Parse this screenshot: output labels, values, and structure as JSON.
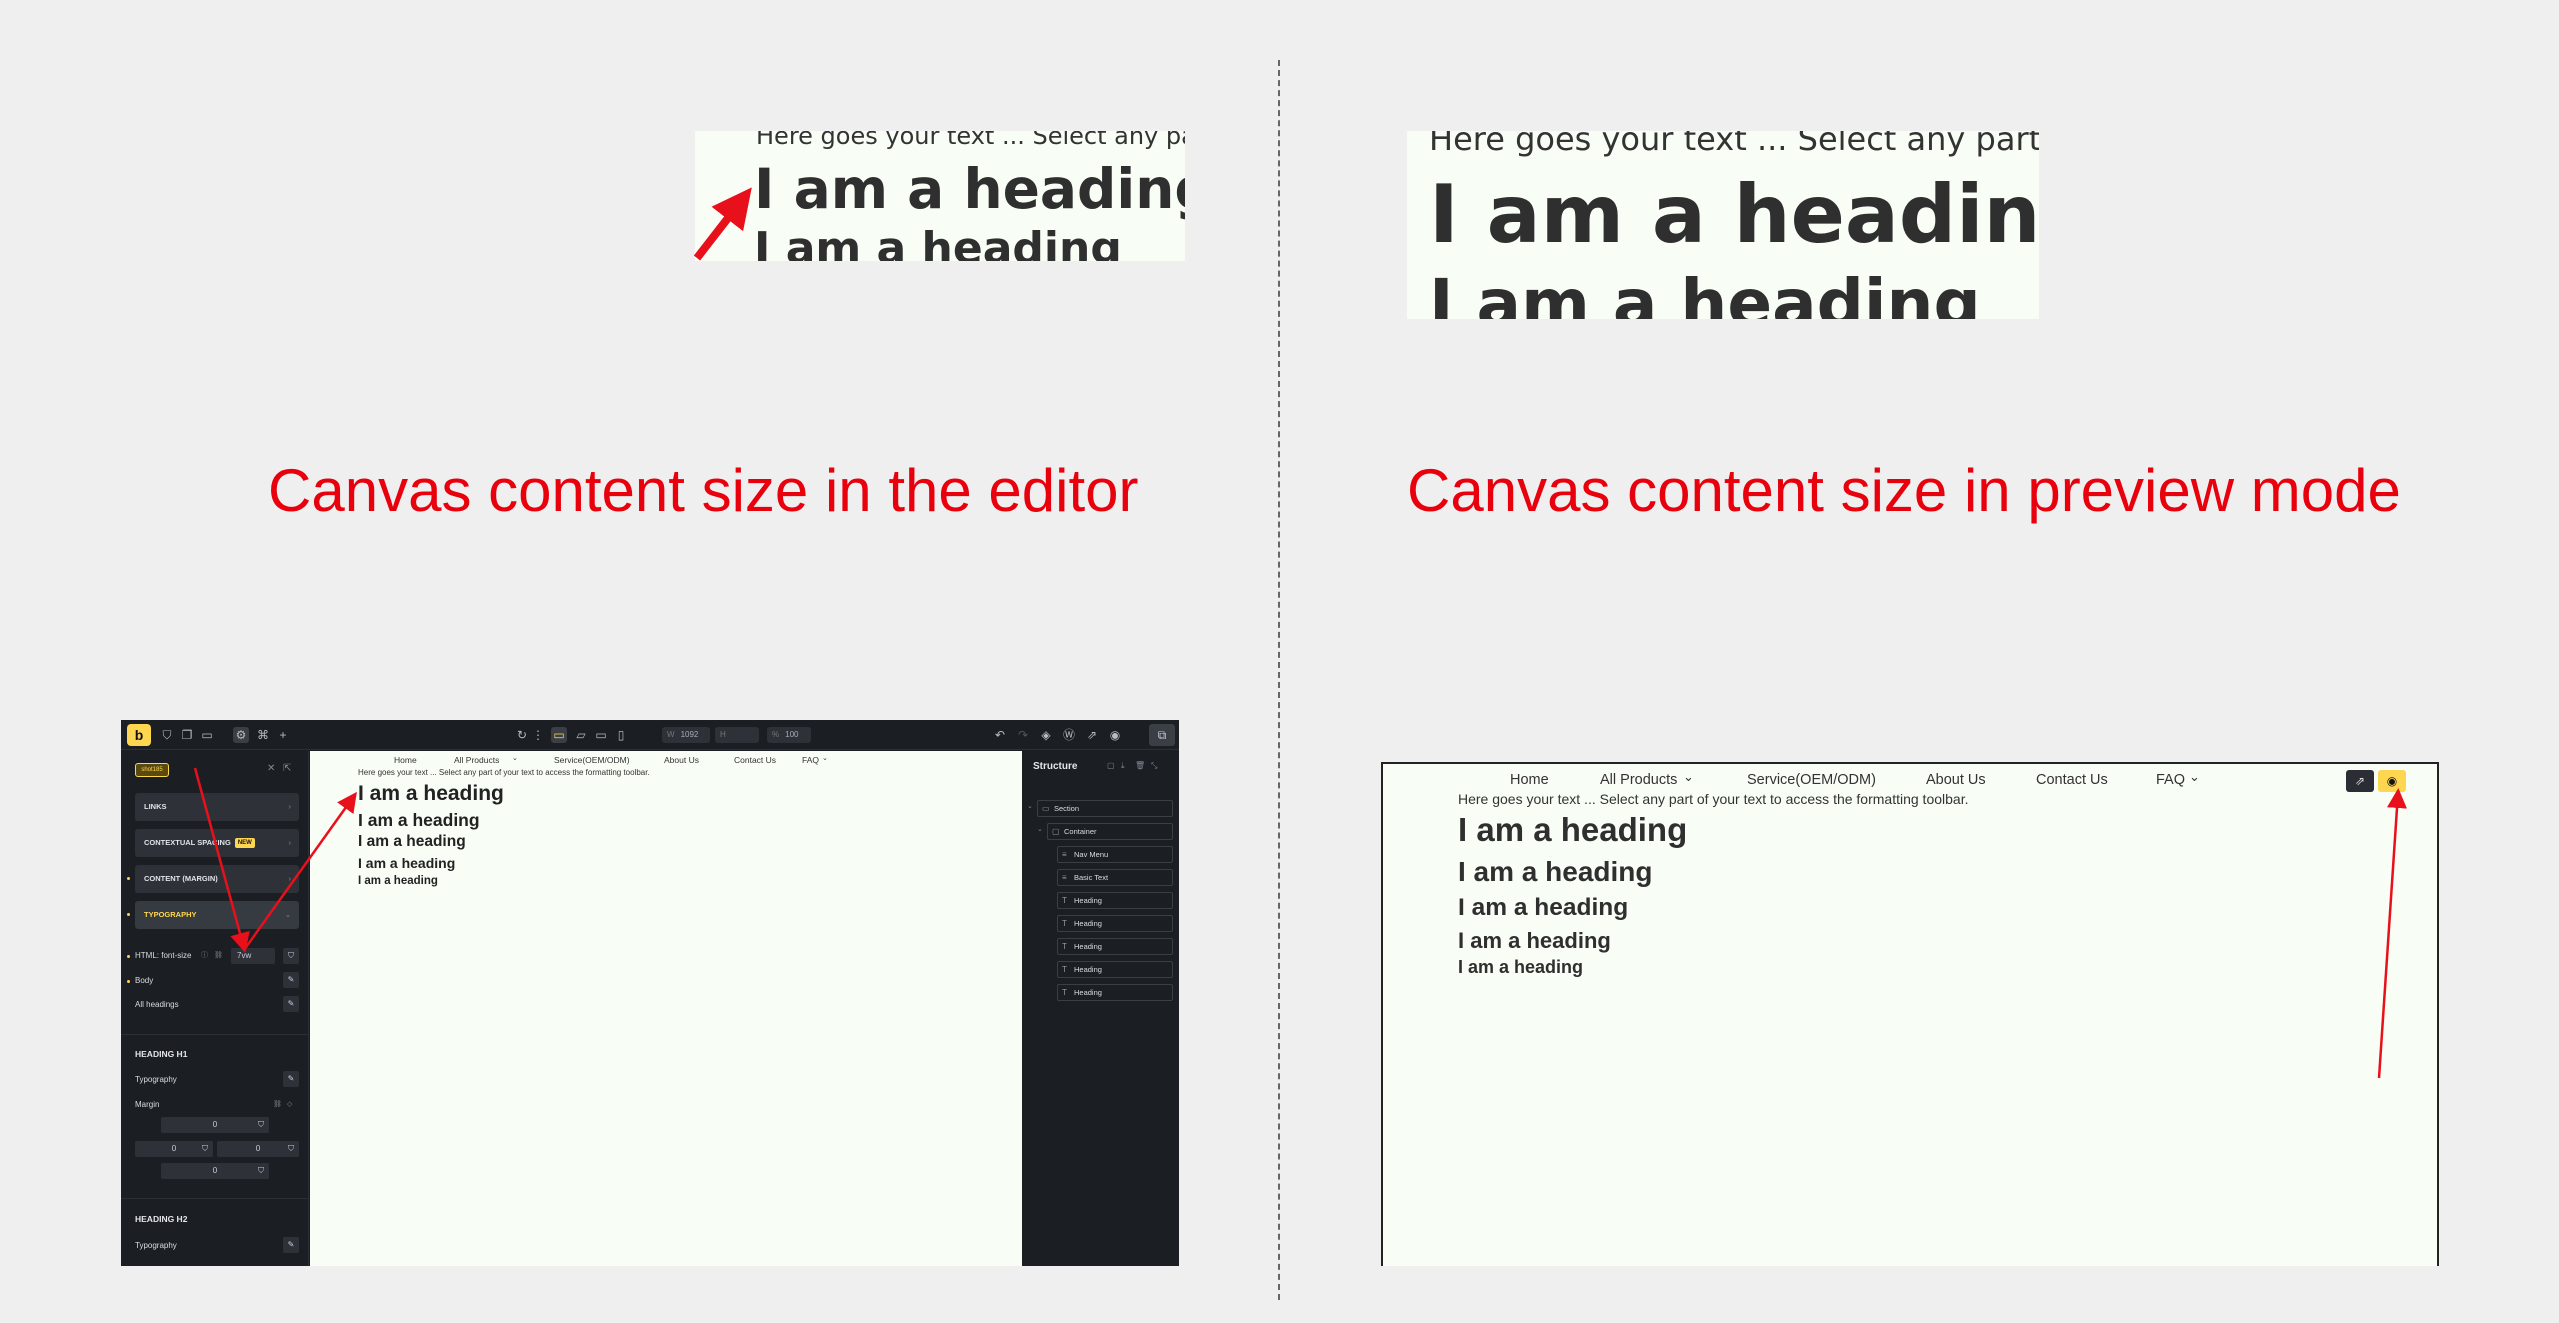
{
  "captions": {
    "editor": "Canvas content size in the editor",
    "preview": "Canvas content size in preview mode"
  },
  "zoom": {
    "text": "Here goes your text ... Select any part of your text to access the formatting toolbar.",
    "heading": "I am a heading"
  },
  "editor": {
    "logo": "b",
    "toolbar": {
      "w_label": "W",
      "w_value": "1092",
      "h_label": "H",
      "h_value": "",
      "pct_label": "%",
      "pct_value": "100"
    },
    "left_panel": {
      "search_tag": "shot185",
      "accordions": {
        "links": "LINKS",
        "spacing": "CONTEXTUAL SPACING",
        "new_badge": "NEW",
        "margin": "CONTENT (MARGIN)",
        "typography": "TYPOGRAPHY"
      },
      "html_font_size": {
        "label": "HTML: font-size",
        "value": "7vw"
      },
      "body": "Body",
      "all_headings": "All headings",
      "h1": {
        "title": "HEADING H1",
        "typography": "Typography",
        "margin": "Margin",
        "margin_values": [
          "0",
          "0",
          "0",
          "0"
        ]
      },
      "h2": {
        "title": "HEADING H2",
        "typography": "Typography"
      }
    },
    "canvas": {
      "nav": [
        "Home",
        "All Products",
        "Service(OEM/ODM)",
        "About Us",
        "Contact Us",
        "FAQ"
      ],
      "text": "Here goes your text ... Select any part of your text to access the formatting toolbar.",
      "headings": [
        "I am a heading",
        "I am a heading",
        "I am a heading",
        "I am a heading",
        "I am a heading"
      ]
    },
    "structure": {
      "title": "Structure",
      "items": [
        "Section",
        "Container",
        "Nav Menu",
        "Basic Text",
        "Heading",
        "Heading",
        "Heading",
        "Heading",
        "Heading"
      ]
    }
  },
  "preview": {
    "nav": [
      "Home",
      "All Products",
      "Service(OEM/ODM)",
      "About Us",
      "Contact Us",
      "FAQ"
    ],
    "text": "Here goes your text ... Select any part of your text to access the formatting toolbar.",
    "headings": [
      "I am a heading",
      "I am a heading",
      "I am a heading",
      "I am a heading",
      "I am a heading"
    ]
  },
  "colors": {
    "accent": "#ffd64f",
    "annotation": "#e8000d",
    "canvas_bg": "#f8fdf6",
    "editor_bg": "#1b1e22"
  }
}
